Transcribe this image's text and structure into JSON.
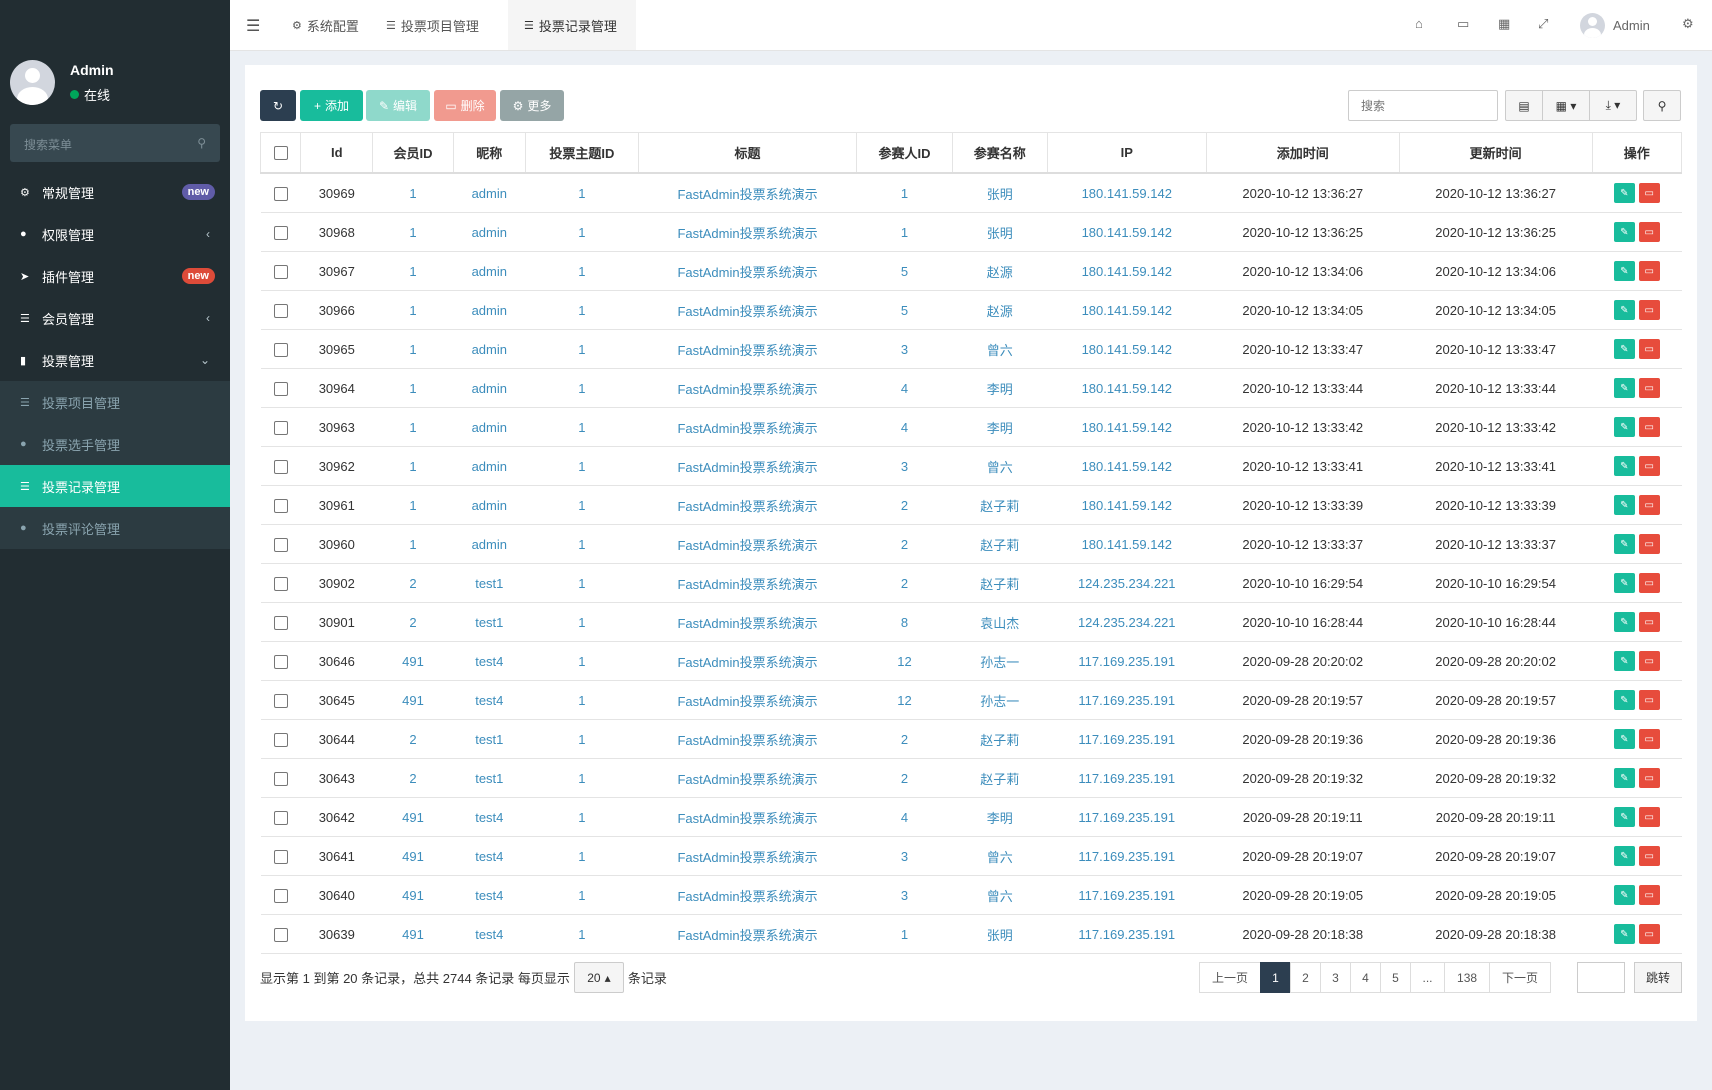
{
  "sidebar": {
    "user": {
      "name": "Admin",
      "status": "在线"
    },
    "search_placeholder": "搜索菜单",
    "items": [
      {
        "label": "常规管理",
        "badge": "new",
        "badge_color": "#605ca8"
      },
      {
        "label": "权限管理"
      },
      {
        "label": "插件管理",
        "badge": "new",
        "badge_color": "#dd4b39"
      },
      {
        "label": "会员管理"
      },
      {
        "label": "投票管理"
      }
    ],
    "subitems": [
      {
        "label": "投票项目管理"
      },
      {
        "label": "投票选手管理"
      },
      {
        "label": "投票记录管理"
      },
      {
        "label": "投票评论管理"
      }
    ]
  },
  "topnav": {
    "tabs": [
      {
        "label": "系统配置"
      },
      {
        "label": "投票项目管理"
      },
      {
        "label": "投票记录管理"
      }
    ],
    "user_name": "Admin"
  },
  "toolbar": {
    "add": "添加",
    "edit": "编辑",
    "delete": "删除",
    "more": "更多",
    "search_placeholder": "搜索"
  },
  "table": {
    "headers": [
      "Id",
      "会员ID",
      "昵称",
      "投票主题ID",
      "标题",
      "参赛人ID",
      "参赛名称",
      "IP",
      "添加时间",
      "更新时间",
      "操作"
    ],
    "rows": [
      [
        "30969",
        "1",
        "admin",
        "1",
        "FastAdmin投票系统演示",
        "1",
        "张明",
        "180.141.59.142",
        "2020-10-12 13:36:27",
        "2020-10-12 13:36:27"
      ],
      [
        "30968",
        "1",
        "admin",
        "1",
        "FastAdmin投票系统演示",
        "1",
        "张明",
        "180.141.59.142",
        "2020-10-12 13:36:25",
        "2020-10-12 13:36:25"
      ],
      [
        "30967",
        "1",
        "admin",
        "1",
        "FastAdmin投票系统演示",
        "5",
        "赵源",
        "180.141.59.142",
        "2020-10-12 13:34:06",
        "2020-10-12 13:34:06"
      ],
      [
        "30966",
        "1",
        "admin",
        "1",
        "FastAdmin投票系统演示",
        "5",
        "赵源",
        "180.141.59.142",
        "2020-10-12 13:34:05",
        "2020-10-12 13:34:05"
      ],
      [
        "30965",
        "1",
        "admin",
        "1",
        "FastAdmin投票系统演示",
        "3",
        "曾六",
        "180.141.59.142",
        "2020-10-12 13:33:47",
        "2020-10-12 13:33:47"
      ],
      [
        "30964",
        "1",
        "admin",
        "1",
        "FastAdmin投票系统演示",
        "4",
        "李明",
        "180.141.59.142",
        "2020-10-12 13:33:44",
        "2020-10-12 13:33:44"
      ],
      [
        "30963",
        "1",
        "admin",
        "1",
        "FastAdmin投票系统演示",
        "4",
        "李明",
        "180.141.59.142",
        "2020-10-12 13:33:42",
        "2020-10-12 13:33:42"
      ],
      [
        "30962",
        "1",
        "admin",
        "1",
        "FastAdmin投票系统演示",
        "3",
        "曾六",
        "180.141.59.142",
        "2020-10-12 13:33:41",
        "2020-10-12 13:33:41"
      ],
      [
        "30961",
        "1",
        "admin",
        "1",
        "FastAdmin投票系统演示",
        "2",
        "赵子莉",
        "180.141.59.142",
        "2020-10-12 13:33:39",
        "2020-10-12 13:33:39"
      ],
      [
        "30960",
        "1",
        "admin",
        "1",
        "FastAdmin投票系统演示",
        "2",
        "赵子莉",
        "180.141.59.142",
        "2020-10-12 13:33:37",
        "2020-10-12 13:33:37"
      ],
      [
        "30902",
        "2",
        "test1",
        "1",
        "FastAdmin投票系统演示",
        "2",
        "赵子莉",
        "124.235.234.221",
        "2020-10-10 16:29:54",
        "2020-10-10 16:29:54"
      ],
      [
        "30901",
        "2",
        "test1",
        "1",
        "FastAdmin投票系统演示",
        "8",
        "袁山杰",
        "124.235.234.221",
        "2020-10-10 16:28:44",
        "2020-10-10 16:28:44"
      ],
      [
        "30646",
        "491",
        "test4",
        "1",
        "FastAdmin投票系统演示",
        "12",
        "孙志一",
        "117.169.235.191",
        "2020-09-28 20:20:02",
        "2020-09-28 20:20:02"
      ],
      [
        "30645",
        "491",
        "test4",
        "1",
        "FastAdmin投票系统演示",
        "12",
        "孙志一",
        "117.169.235.191",
        "2020-09-28 20:19:57",
        "2020-09-28 20:19:57"
      ],
      [
        "30644",
        "2",
        "test1",
        "1",
        "FastAdmin投票系统演示",
        "2",
        "赵子莉",
        "117.169.235.191",
        "2020-09-28 20:19:36",
        "2020-09-28 20:19:36"
      ],
      [
        "30643",
        "2",
        "test1",
        "1",
        "FastAdmin投票系统演示",
        "2",
        "赵子莉",
        "117.169.235.191",
        "2020-09-28 20:19:32",
        "2020-09-28 20:19:32"
      ],
      [
        "30642",
        "491",
        "test4",
        "1",
        "FastAdmin投票系统演示",
        "4",
        "李明",
        "117.169.235.191",
        "2020-09-28 20:19:11",
        "2020-09-28 20:19:11"
      ],
      [
        "30641",
        "491",
        "test4",
        "1",
        "FastAdmin投票系统演示",
        "3",
        "曾六",
        "117.169.235.191",
        "2020-09-28 20:19:07",
        "2020-09-28 20:19:07"
      ],
      [
        "30640",
        "491",
        "test4",
        "1",
        "FastAdmin投票系统演示",
        "3",
        "曾六",
        "117.169.235.191",
        "2020-09-28 20:19:05",
        "2020-09-28 20:19:05"
      ],
      [
        "30639",
        "491",
        "test4",
        "1",
        "FastAdmin投票系统演示",
        "1",
        "张明",
        "117.169.235.191",
        "2020-09-28 20:18:38",
        "2020-09-28 20:18:38"
      ]
    ]
  },
  "pagination": {
    "info": "显示第 1 到第 20 条记录，总共 2744 条记录 每页显示",
    "page_size": "20",
    "suffix": "条记录",
    "prev": "上一页",
    "pages": [
      "1",
      "2",
      "3",
      "4",
      "5",
      "...",
      "138"
    ],
    "next": "下一页",
    "jump": "跳转"
  }
}
